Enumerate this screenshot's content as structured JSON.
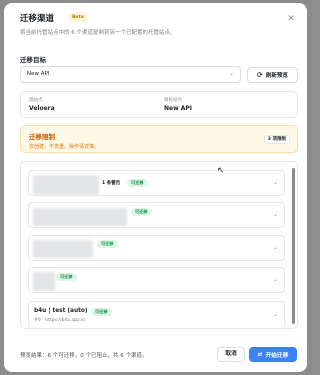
{
  "modal": {
    "title": "迁移渠道",
    "beta": "Beta",
    "subtitle": "将当前托管站点中的 6 个渠道复制到另一个已配置的托管站点。",
    "close_icon": "close-icon"
  },
  "target": {
    "label": "迁移目标",
    "selected": "New API",
    "refresh_label": "刷新预览"
  },
  "sites": {
    "source_label": "源站点",
    "source_name": "Veloera",
    "target_label": "目标站点",
    "target_name": "New API"
  },
  "limit": {
    "title": "迁移限制",
    "desc": "仅创建，不去重。操作请详慎。",
    "tag": "3 项限制"
  },
  "rows": [
    {
      "warning": "1 条警告",
      "status": "可迁移"
    },
    {
      "status": "可迁移"
    },
    {
      "status": "可迁移"
    },
    {
      "status": "可迁移"
    },
    {
      "name": "b4u | test (auto)",
      "status": "可迁移",
      "sub": "#9 · https://b4u.qzz.io"
    }
  ],
  "footer": {
    "summary": "预览结果：6 个可迁移，0 个已阻止，共 6 个渠道。",
    "cancel": "取消",
    "start": "开始迁移"
  },
  "colors": {
    "primary": "#3b82f6",
    "warning_bg": "#fff8e6",
    "warning_text": "#c25c00",
    "success_bg": "#dcf5e6",
    "success_text": "#1a8f4c"
  }
}
